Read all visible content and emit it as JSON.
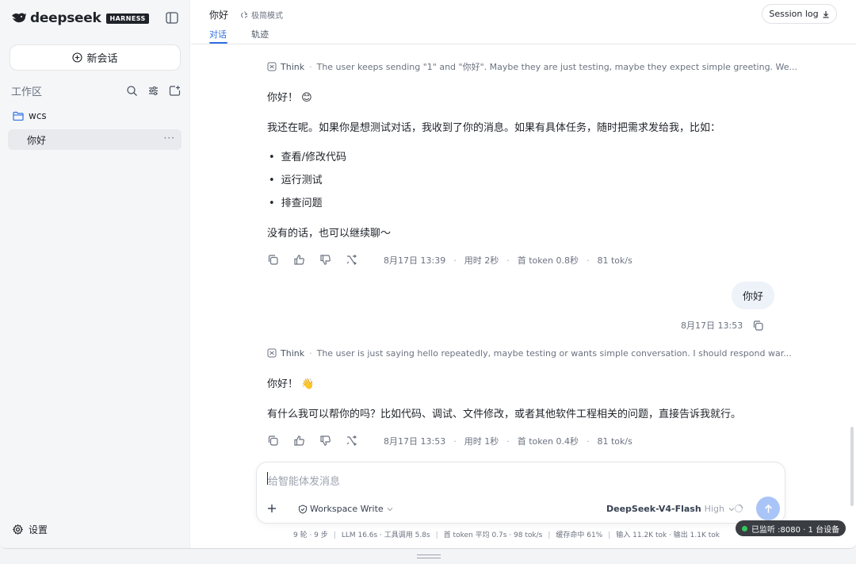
{
  "sidebar": {
    "brand": "deepseek",
    "brand_tag": "HARNESS",
    "new_chat": "新会话",
    "workspace_title": "工作区",
    "folder": "wcs",
    "session": "你好",
    "session_more": "···",
    "settings": "设置"
  },
  "topbar": {
    "title": "你好",
    "mode": "极简模式",
    "tabs": [
      "对话",
      "轨迹"
    ],
    "session_log": "Session log"
  },
  "messages": {
    "first": {
      "think_label": "Think",
      "think_text": "The user keeps sending \"1\" and \"你好\". Maybe they are just testing, maybe they expect simple greeting. We...",
      "greeting": "你好！",
      "greeting_emoji": "😊",
      "paragraph": "我还在呢。如果你是想测试对话，我收到了你的消息。如果有具体任务，随时把需求发给我，比如：",
      "bullets": [
        "查看/修改代码",
        "运行测试",
        "排查问题"
      ],
      "closing": "没有的话，也可以继续聊～",
      "timestamp": "8月17日 13:39",
      "duration": "用时 2秒",
      "first_token": "首 token 0.8秒",
      "speed": "81 tok/s"
    },
    "user": {
      "text": "你好",
      "timestamp": "8月17日 13:53"
    },
    "second": {
      "think_label": "Think",
      "think_text": "The user is just saying hello repeatedly, maybe testing or wants simple conversation. I should respond war...",
      "greeting": "你好！",
      "greeting_emoji": "👋",
      "paragraph": "有什么我可以帮你的吗？比如代码、调试、文件修改，或者其他软件工程相关的问题，直接告诉我就行。",
      "timestamp": "8月17日 13:53",
      "duration": "用时 1秒",
      "first_token": "首 token 0.4秒",
      "speed": "81 tok/s"
    }
  },
  "composer": {
    "placeholder": "给智能体发消息",
    "workspace_mode": "Workspace Write",
    "model": "DeepSeek-V4-Flash",
    "model_level": "High"
  },
  "statusbar": {
    "turns": "9 轮 · 9 步",
    "llm": "LLM 16.6s · 工具调用 5.8s",
    "token_avg": "首 token 平均 0.7s · 98 tok/s",
    "cache": "缓存命中 61%",
    "io": "输入 11.2K tok · 输出 1.1K tok"
  },
  "listen_badge": "已监听 :8080 · 1 台设备",
  "colors": {
    "accent": "#2f6fe4",
    "send_button": "#a9c4f6",
    "status_green": "#34c759"
  }
}
